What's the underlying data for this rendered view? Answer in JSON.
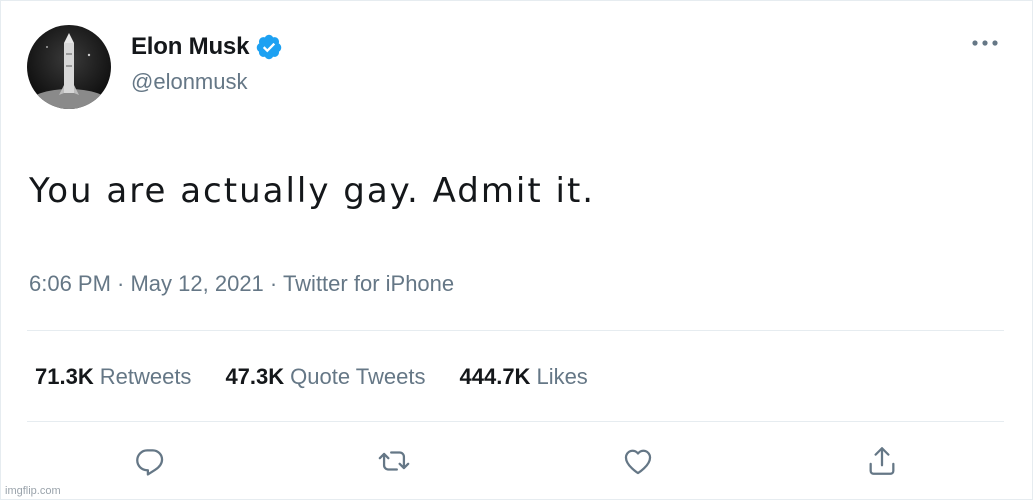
{
  "user": {
    "display_name": "Elon Musk",
    "handle": "@elonmusk",
    "verified": true,
    "avatar_icon": "avatar-rocket"
  },
  "tweet": {
    "text": "You are actually gay. Admit it.",
    "meta": "6:06 PM · May 12, 2021 · Twitter for iPhone"
  },
  "stats": [
    {
      "value": "71.3K",
      "label": "Retweets"
    },
    {
      "value": "47.3K",
      "label": "Quote Tweets"
    },
    {
      "value": "444.7K",
      "label": "Likes"
    }
  ],
  "actions": [
    {
      "icon": "reply-icon"
    },
    {
      "icon": "retweet-icon"
    },
    {
      "icon": "like-icon"
    },
    {
      "icon": "share-icon"
    }
  ],
  "colors": {
    "text_primary": "#14171a",
    "text_secondary": "#657786",
    "verified_blue": "#1da1f2",
    "divider": "#e6ecf0"
  },
  "watermark": "imgflip.com"
}
